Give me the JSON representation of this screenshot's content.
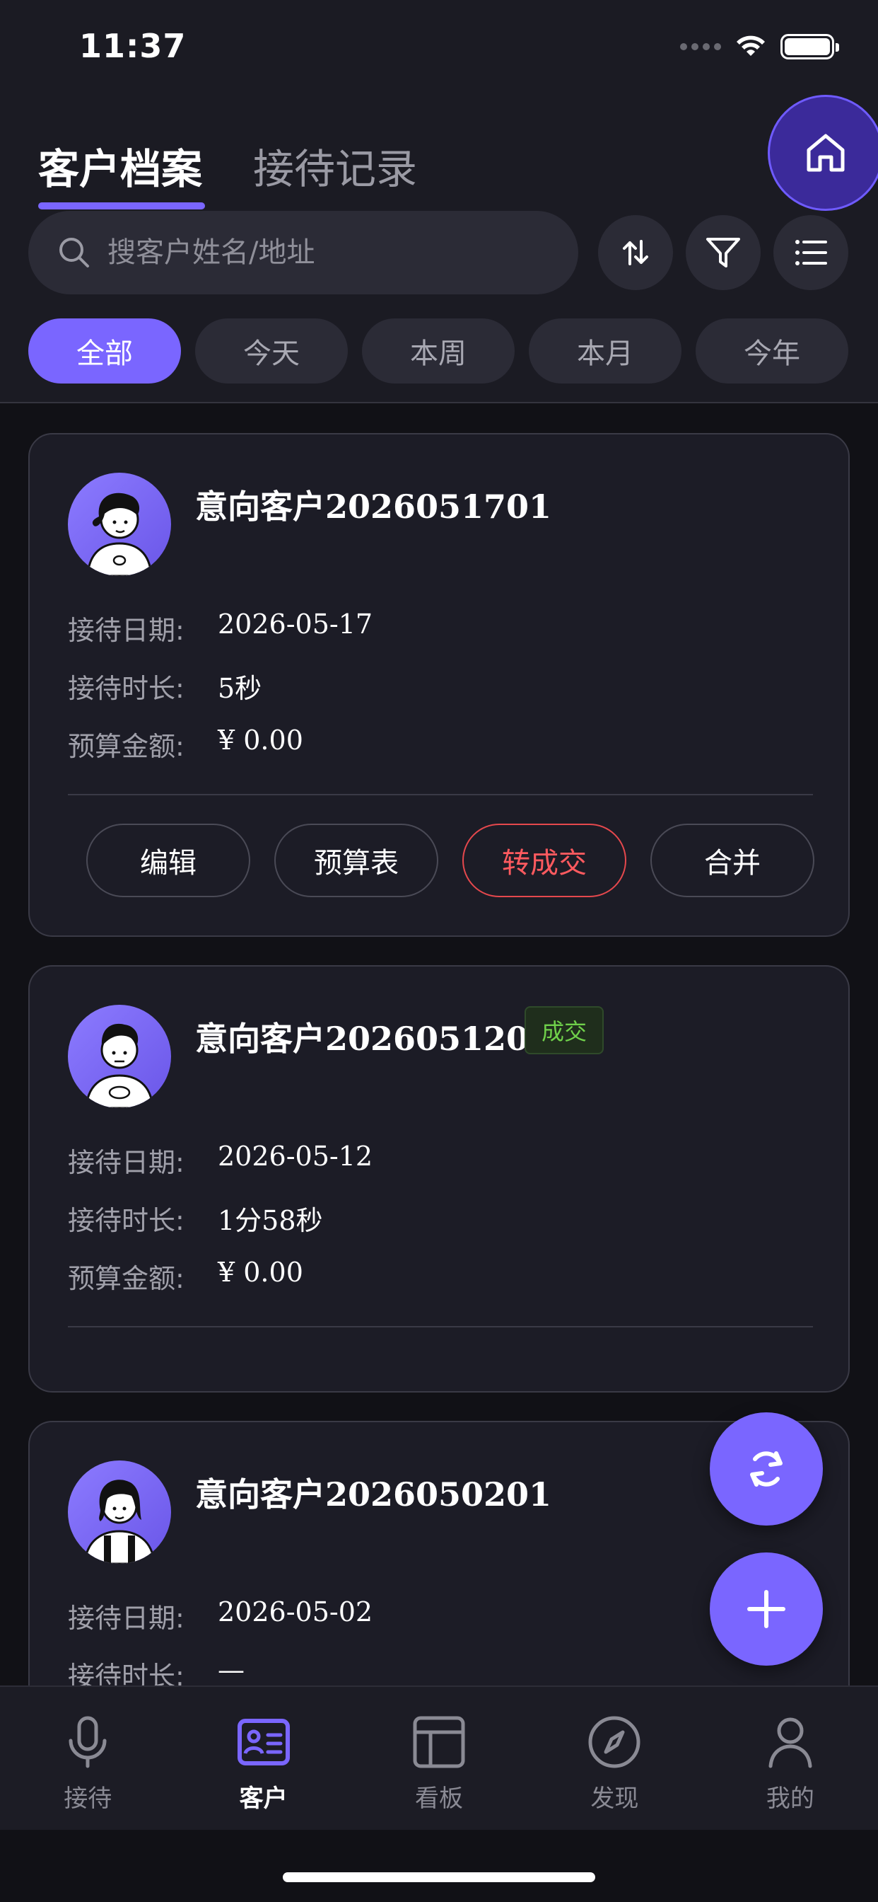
{
  "status_bar": {
    "time": "11:37"
  },
  "tabs": [
    {
      "label": "客户档案",
      "active": true
    },
    {
      "label": "接待记录",
      "active": false
    }
  ],
  "search": {
    "placeholder": "搜客户姓名/地址"
  },
  "toolbar": {
    "icons": [
      "sort-icon",
      "filter-icon",
      "list-icon"
    ]
  },
  "filters": [
    {
      "label": "全部",
      "active": true
    },
    {
      "label": "今天",
      "active": false
    },
    {
      "label": "本周",
      "active": false
    },
    {
      "label": "本月",
      "active": false
    },
    {
      "label": "今年",
      "active": false
    }
  ],
  "customers": [
    {
      "name": "意向客户2026051701",
      "badge": "",
      "date_label": "接待日期:",
      "date": "2026-05-17",
      "duration_label": "接待时长:",
      "duration": "5秒",
      "budget_label": "预算金额:",
      "budget": "¥ 0.00",
      "actions": [
        "编辑",
        "预算表",
        "转成交",
        "合并"
      ]
    },
    {
      "name": "意向客户2026051202",
      "badge": "成交",
      "date_label": "接待日期:",
      "date": "2026-05-12",
      "duration_label": "接待时长:",
      "duration": "1分58秒",
      "budget_label": "预算金额:",
      "budget": "¥ 0.00"
    },
    {
      "name": "意向客户2026050201",
      "badge": "",
      "date_label": "接待日期:",
      "date": "2026-05-02",
      "duration_label": "接待时长:",
      "duration": "—"
    }
  ],
  "bottom_nav": [
    {
      "label": "接待",
      "icon": "mic-icon",
      "active": false
    },
    {
      "label": "客户",
      "icon": "contact-card-icon",
      "active": true
    },
    {
      "label": "看板",
      "icon": "dashboard-icon",
      "active": false
    },
    {
      "label": "发现",
      "icon": "compass-icon",
      "active": false
    },
    {
      "label": "我的",
      "icon": "user-icon",
      "active": false
    }
  ],
  "colors": {
    "accent": "#7a66ff",
    "background": "#111116",
    "card": "#1c1c26",
    "danger": "#ff5a5f",
    "success": "#6fd04a"
  }
}
